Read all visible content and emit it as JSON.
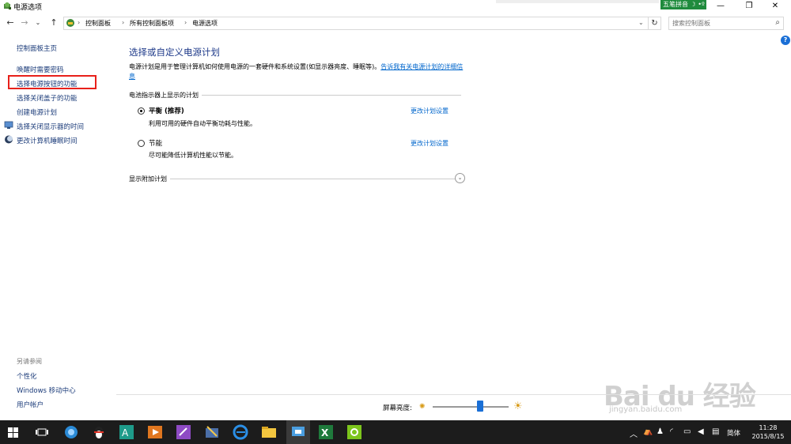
{
  "window": {
    "title": "电源选项",
    "ime_label": "五笔拼音",
    "controls": {
      "minimize": "—",
      "restore": "❐",
      "close": "✕"
    }
  },
  "addressbar": {
    "breadcrumbs": [
      "控制面板",
      "所有控制面板项",
      "电源选项"
    ],
    "search_placeholder": "搜索控制面板",
    "help": "?"
  },
  "sidebar": {
    "home": "控制面板主页",
    "links": [
      "唤醒时需要密码",
      "选择电源按钮的功能",
      "选择关闭盖子的功能",
      "创建电源计划",
      "选择关闭显示器的时间",
      "更改计算机睡眠时间"
    ],
    "see_also_title": "另请参阅",
    "see_also": [
      "个性化",
      "Windows 移动中心",
      "用户帐户"
    ]
  },
  "main": {
    "title": "选择或自定义电源计划",
    "description": "电源计划是用于管理计算机如何使用电源的一套硬件和系统设置(如显示器亮度、睡眠等)。",
    "description_link": "告诉我有关电源计划的详细信息",
    "group_label": "电池指示器上显示的计划",
    "plans": [
      {
        "name": "平衡 (推荐)",
        "desc": "利用可用的硬件自动平衡功耗与性能。",
        "link": "更改计划设置",
        "selected": true
      },
      {
        "name": "节能",
        "desc": "尽可能降低计算机性能以节能。",
        "link": "更改计划设置",
        "selected": false
      }
    ],
    "extra_plans": "显示附加计划"
  },
  "brightness": {
    "label": "屏幕亮度:",
    "level_percent": 63
  },
  "watermark": {
    "main": "Bai du 经验",
    "sub": "jingyan.baidu.com"
  },
  "taskbar": {
    "ime": "简体",
    "time": "11:28",
    "date": "2015/8/15"
  },
  "colors": {
    "link": "#1c3c7a",
    "heading": "#1e3a8a",
    "accent": "#1a6fd6",
    "highlight": "#e8201a"
  }
}
